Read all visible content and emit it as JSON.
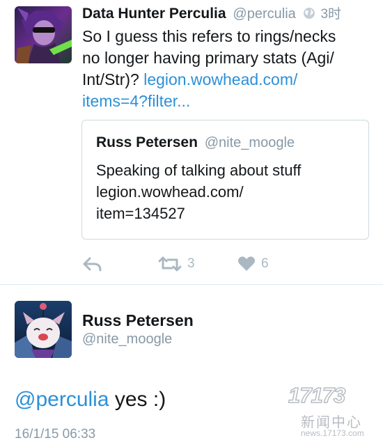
{
  "tweet": {
    "author_name": "Data Hunter Perculia",
    "author_handle": "@perculia",
    "time": "3时",
    "text_lines": [
      "So I guess this refers to rings/necks",
      "no longer having primary stats (Agi/",
      "Int/Str)?"
    ],
    "link_line1": "legion.wowhead.com/",
    "link_line2": "items=4?filter...",
    "quoted": {
      "author_name": "Russ Petersen",
      "author_handle": "@nite_moogle",
      "text_lines": [
        "Speaking of talking about stuff",
        "legion.wowhead.com/",
        "item=134527"
      ]
    },
    "actions": {
      "reply_icon": "reply-icon",
      "retweet_icon": "retweet-icon",
      "retweet_count": "3",
      "like_icon": "heart-icon",
      "like_count": "6"
    }
  },
  "reply_tweet": {
    "author_name": "Russ Petersen",
    "author_handle": "@nite_moogle",
    "mention": "@perculia",
    "text": " yes :)",
    "timestamp": "16/1/15 06:33"
  },
  "watermark": {
    "logo": "17173",
    "chinese": "新闻中心",
    "url": "news.17173.com"
  },
  "colors": {
    "link": "#2b90d9",
    "secondary_text": "#8899a6",
    "action_icon": "#aab8c2",
    "border": "#cfd9de"
  }
}
